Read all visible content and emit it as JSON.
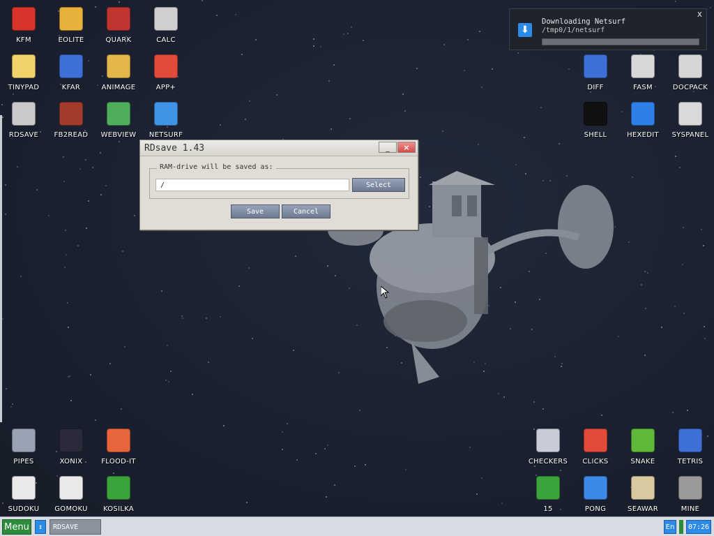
{
  "desktop": {
    "icons": [
      {
        "label": "KFM",
        "icon": "floppy-disk-icon",
        "color": "#d9342b"
      },
      {
        "label": "EOLITE",
        "icon": "folder-icon",
        "color": "#e8b23a"
      },
      {
        "label": "QUARK",
        "icon": "notebook-icon",
        "color": "#c0352f"
      },
      {
        "label": "CALC",
        "icon": "calculator-icon",
        "color": "#cfcfcf"
      },
      {
        "label": "TINYPAD",
        "icon": "notepad-icon",
        "color": "#f2d36b"
      },
      {
        "label": "KFAR",
        "icon": "file-manager-icon",
        "color": "#3d6fd6"
      },
      {
        "label": "ANIMAGE",
        "icon": "pencil-ruler-icon",
        "color": "#e3b64a"
      },
      {
        "label": "APP+",
        "icon": "rubik-cube-icon",
        "color": "#e24a3a"
      },
      {
        "label": "RDSAVE",
        "icon": "ram-drive-icon",
        "color": "#c9c9c9"
      },
      {
        "label": "FB2READ",
        "icon": "book-icon",
        "color": "#a23b2c"
      },
      {
        "label": "WEBVIEW",
        "icon": "webview-icon",
        "color": "#4fae5b"
      },
      {
        "label": "NETSURF",
        "icon": "globe-icon",
        "color": "#3f94e8"
      },
      {
        "label": "DIFF",
        "icon": "compare-icon",
        "color": "#3d6fd6"
      },
      {
        "label": "FASM",
        "icon": "assembler-icon",
        "color": "#d8d8d8"
      },
      {
        "label": "DOCPACK",
        "icon": "cabinet-icon",
        "color": "#d6d6d6"
      },
      {
        "label": "SHELL",
        "icon": "terminal-icon",
        "color": "#111111"
      },
      {
        "label": "HEXEDIT",
        "icon": "hex-editor-icon",
        "color": "#2f7fe8"
      },
      {
        "label": "SYSPANEL",
        "icon": "settings-sliders-icon",
        "color": "#d9d9d9"
      },
      {
        "label": "PIPES",
        "icon": "pipes-icon",
        "color": "#9aa3b4"
      },
      {
        "label": "XONIX",
        "icon": "xonix-icon",
        "color": "#2a2a3a"
      },
      {
        "label": "FLOOD-IT",
        "icon": "color-grid-icon",
        "color": "#e8643a"
      },
      {
        "label": "SUDOKU",
        "icon": "sudoku-icon",
        "color": "#e9e9e9"
      },
      {
        "label": "GOMOKU",
        "icon": "gomoku-icon",
        "color": "#e9e9e9"
      },
      {
        "label": "KOSILKA",
        "icon": "lawn-mower-icon",
        "color": "#3aa33a"
      },
      {
        "label": "CHECKERS",
        "icon": "checkers-icon",
        "color": "#c7ccd6"
      },
      {
        "label": "CLICKS",
        "icon": "blocks-icon",
        "color": "#e24a3a"
      },
      {
        "label": "SNAKE",
        "icon": "snake-icon",
        "color": "#5fb83a"
      },
      {
        "label": "TETRIS",
        "icon": "tetris-icon",
        "color": "#3d6fd6"
      },
      {
        "label": "15",
        "icon": "fifteen-puzzle-icon",
        "color": "#3aa33a"
      },
      {
        "label": "PONG",
        "icon": "pong-icon",
        "color": "#3d8ae6"
      },
      {
        "label": "SEAWAR",
        "icon": "sea-battle-icon",
        "color": "#d9c9a0"
      },
      {
        "label": "MINE",
        "icon": "mine-icon",
        "color": "#9a9a9a"
      }
    ]
  },
  "notification": {
    "title": "Downloading Netsurf",
    "path": "/tmp0/1/netsurf",
    "progress": 0,
    "close": "x"
  },
  "dialog": {
    "title": "RDsave 1.43",
    "minimize": "_",
    "close": "×",
    "group_label": "RAM-drive will be saved as:",
    "path_value": "/",
    "select_label": "Select",
    "save_label": "Save",
    "cancel_label": "Cancel"
  },
  "taskbar": {
    "menu_label": "Menu",
    "switch_icon": "↕",
    "task_label": "RDSAVE",
    "language": "En",
    "clock": "07:26"
  }
}
